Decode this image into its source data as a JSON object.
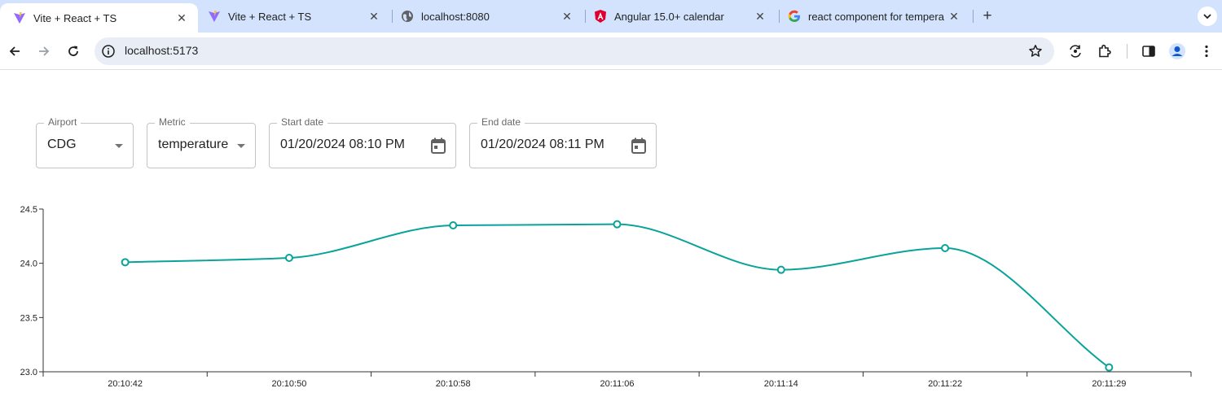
{
  "browser": {
    "tabs": [
      {
        "title": "Vite + React + TS",
        "favicon": "vite-icon",
        "active": true
      },
      {
        "title": "Vite + React + TS",
        "favicon": "vite-icon",
        "active": false
      },
      {
        "title": "localhost:8080",
        "favicon": "globe-icon",
        "active": false
      },
      {
        "title": "Angular 15.0+ calendar",
        "favicon": "angular-icon",
        "active": false
      },
      {
        "title": "react component for tempera",
        "favicon": "google-icon",
        "active": false
      }
    ],
    "url": "localhost:5173"
  },
  "filters": {
    "airport": {
      "label": "Airport",
      "value": "CDG"
    },
    "metric": {
      "label": "Metric",
      "value": "temperature"
    },
    "start_date": {
      "label": "Start date",
      "value": "01/20/2024 08:10 PM"
    },
    "end_date": {
      "label": "End date",
      "value": "01/20/2024 08:11 PM"
    }
  },
  "chart_data": {
    "type": "line",
    "title": "",
    "xlabel": "",
    "ylabel": "",
    "x": [
      "20:10:42",
      "20:10:50",
      "20:10:58",
      "20:11:06",
      "20:11:14",
      "20:11:22",
      "20:11:29"
    ],
    "series": [
      {
        "values": [
          24.01,
          24.05,
          24.35,
          24.36,
          23.94,
          24.14,
          23.04
        ],
        "color": "#0aa39a"
      }
    ],
    "yticks": [
      "23.0",
      "23.5",
      "24.0",
      "24.5"
    ],
    "ylim": [
      23.0,
      24.5
    ],
    "grid": false,
    "interpolation": "smooth"
  }
}
